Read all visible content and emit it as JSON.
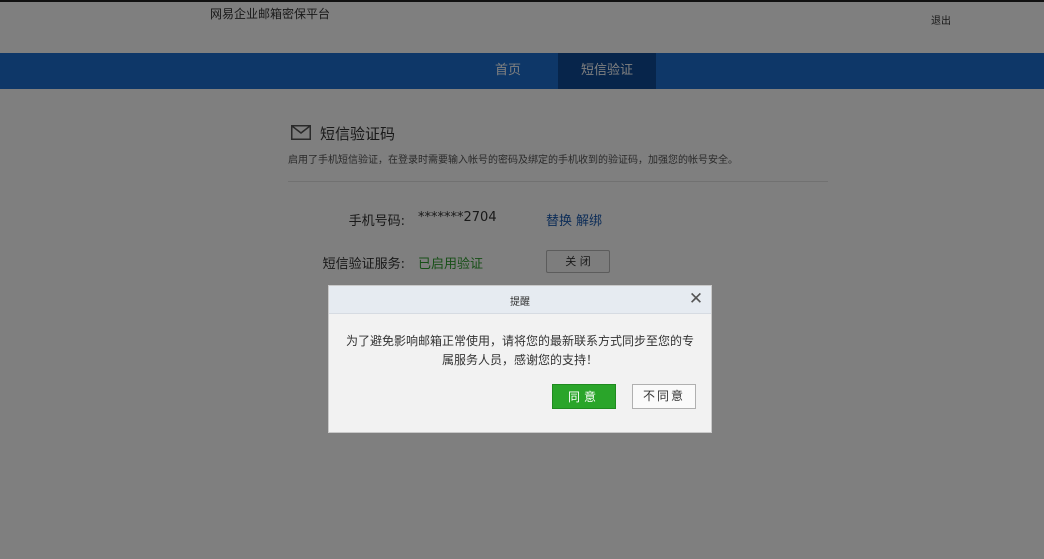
{
  "header": {
    "brand": "网易企业邮箱密保平台",
    "logout": "退出"
  },
  "nav": {
    "items": [
      {
        "label": "首页",
        "active": false
      },
      {
        "label": "短信验证",
        "active": true
      }
    ]
  },
  "section": {
    "icon": "envelope-icon",
    "title": "短信验证码",
    "description": "启用了手机短信验证，在登录时需要输入帐号的密码及绑定的手机收到的验证码，加强您的帐号安全。"
  },
  "phone": {
    "label": "手机号码:",
    "value": "*******2704",
    "replace": "替换",
    "unbind": "解绑"
  },
  "service": {
    "label": "短信验证服务:",
    "status": "已启用验证",
    "close_button": "关 闭"
  },
  "dialog": {
    "title": "提醒",
    "close_icon": "close-icon",
    "message": "为了避免影响邮箱正常使用，请将您的最新联系方式同步至您的专属服务人员，感谢您的支持！",
    "agree": "同意",
    "disagree": "不同意"
  },
  "colors": {
    "nav_bg": "#1d6fd1",
    "nav_active_bg": "#0e4a96",
    "link": "#1a5bb0",
    "status_green": "#2f9e2f",
    "agree_green": "#2aa52a",
    "overlay": "rgba(0,0,0,0.5)"
  }
}
